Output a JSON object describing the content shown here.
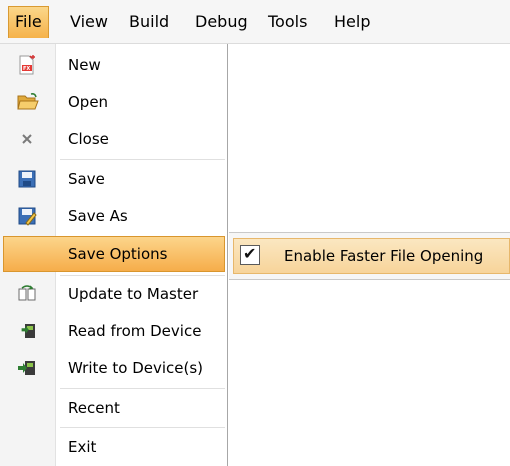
{
  "menubar": {
    "items": [
      "File",
      "View",
      "Build",
      "Debug",
      "Tools",
      "Help"
    ]
  },
  "file_menu": {
    "items": [
      {
        "label": "New",
        "icon": "new-document-icon"
      },
      {
        "label": "Open",
        "icon": "folder-open-icon"
      },
      {
        "label": "Close",
        "icon": "close-icon"
      },
      {
        "label": "Save",
        "icon": "save-icon"
      },
      {
        "label": "Save As",
        "icon": "save-as-icon"
      },
      {
        "label": "Save Options",
        "icon": ""
      },
      {
        "label": "Update to Master",
        "icon": "update-master-icon"
      },
      {
        "label": "Read from Device",
        "icon": "read-device-icon"
      },
      {
        "label": "Write to Device(s)",
        "icon": "write-device-icon"
      },
      {
        "label": "Recent",
        "icon": ""
      },
      {
        "label": "Exit",
        "icon": ""
      }
    ],
    "highlighted": "Save Options"
  },
  "save_options_submenu": {
    "item": {
      "label": "Enable Faster File Opening",
      "checked": true,
      "check_glyph": "✔"
    }
  },
  "colors": {
    "highlight": "#f6ad4a",
    "menubar_bg": "#f6f6f6"
  }
}
